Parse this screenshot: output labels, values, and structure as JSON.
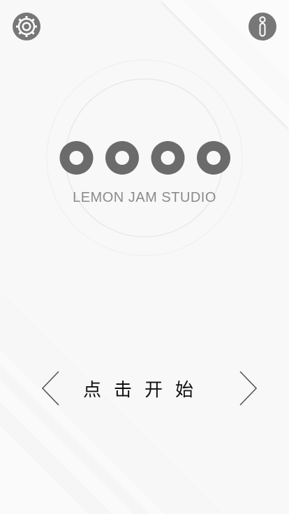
{
  "brand": {
    "name": "LEMON JAM STUDIO"
  },
  "menu": {
    "start_label": "点击开始"
  },
  "icons": {
    "settings": "gear-icon",
    "info": "info-icon",
    "prev": "chevron-left-icon",
    "next": "chevron-right-icon"
  },
  "colors": {
    "background": "#f8f8f8",
    "icon_fill": "#777777",
    "logo_ring": "#6b6b6b",
    "text_dark": "#111111",
    "text_muted": "#8a8a8a"
  }
}
